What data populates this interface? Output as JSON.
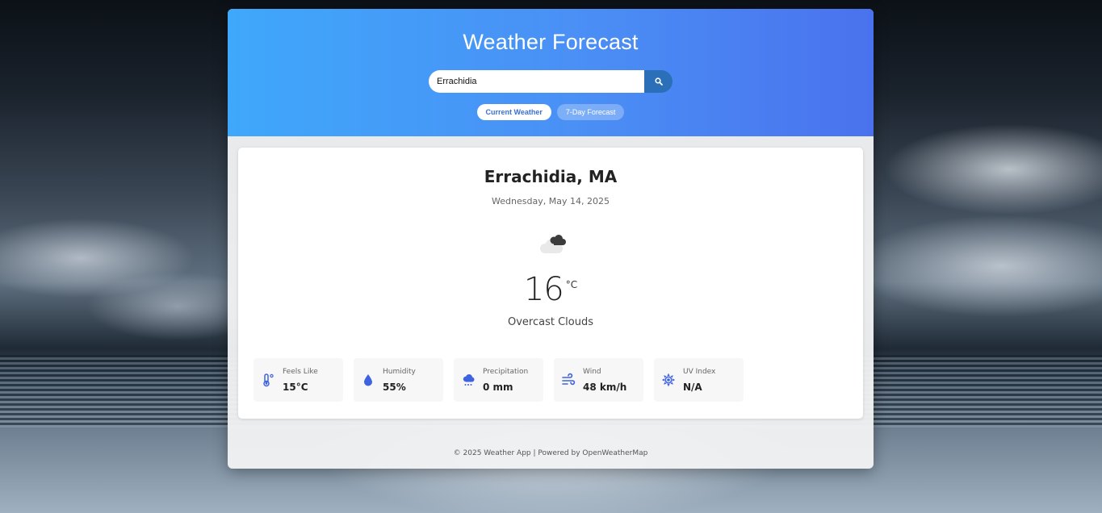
{
  "header": {
    "title": "Weather Forecast"
  },
  "search": {
    "value": "Errachidia",
    "button_icon": "search-icon"
  },
  "tabs": [
    {
      "label": "Current Weather",
      "active": true
    },
    {
      "label": "7-Day Forecast",
      "active": false
    }
  ],
  "current": {
    "location": "Errachidia, MA",
    "date": "Wednesday, May 14, 2025",
    "icon": "overcast-clouds-icon",
    "temperature": "16",
    "unit": "°C",
    "condition": "Overcast Clouds"
  },
  "details": [
    {
      "label": "Feels Like",
      "value": "15°C",
      "icon": "thermometer-icon"
    },
    {
      "label": "Humidity",
      "value": "55%",
      "icon": "droplet-icon"
    },
    {
      "label": "Precipitation",
      "value": "0 mm",
      "icon": "cloud-rain-icon"
    },
    {
      "label": "Wind",
      "value": "48 km/h",
      "icon": "wind-icon"
    },
    {
      "label": "UV Index",
      "value": "N/A",
      "icon": "sun-icon"
    }
  ],
  "footer": {
    "text": "© 2025 Weather App | Powered by OpenWeatherMap"
  },
  "colors": {
    "accent": "#4a8ff5",
    "search_button": "#2a6fb7",
    "icon_blue": "#3f63e0"
  }
}
